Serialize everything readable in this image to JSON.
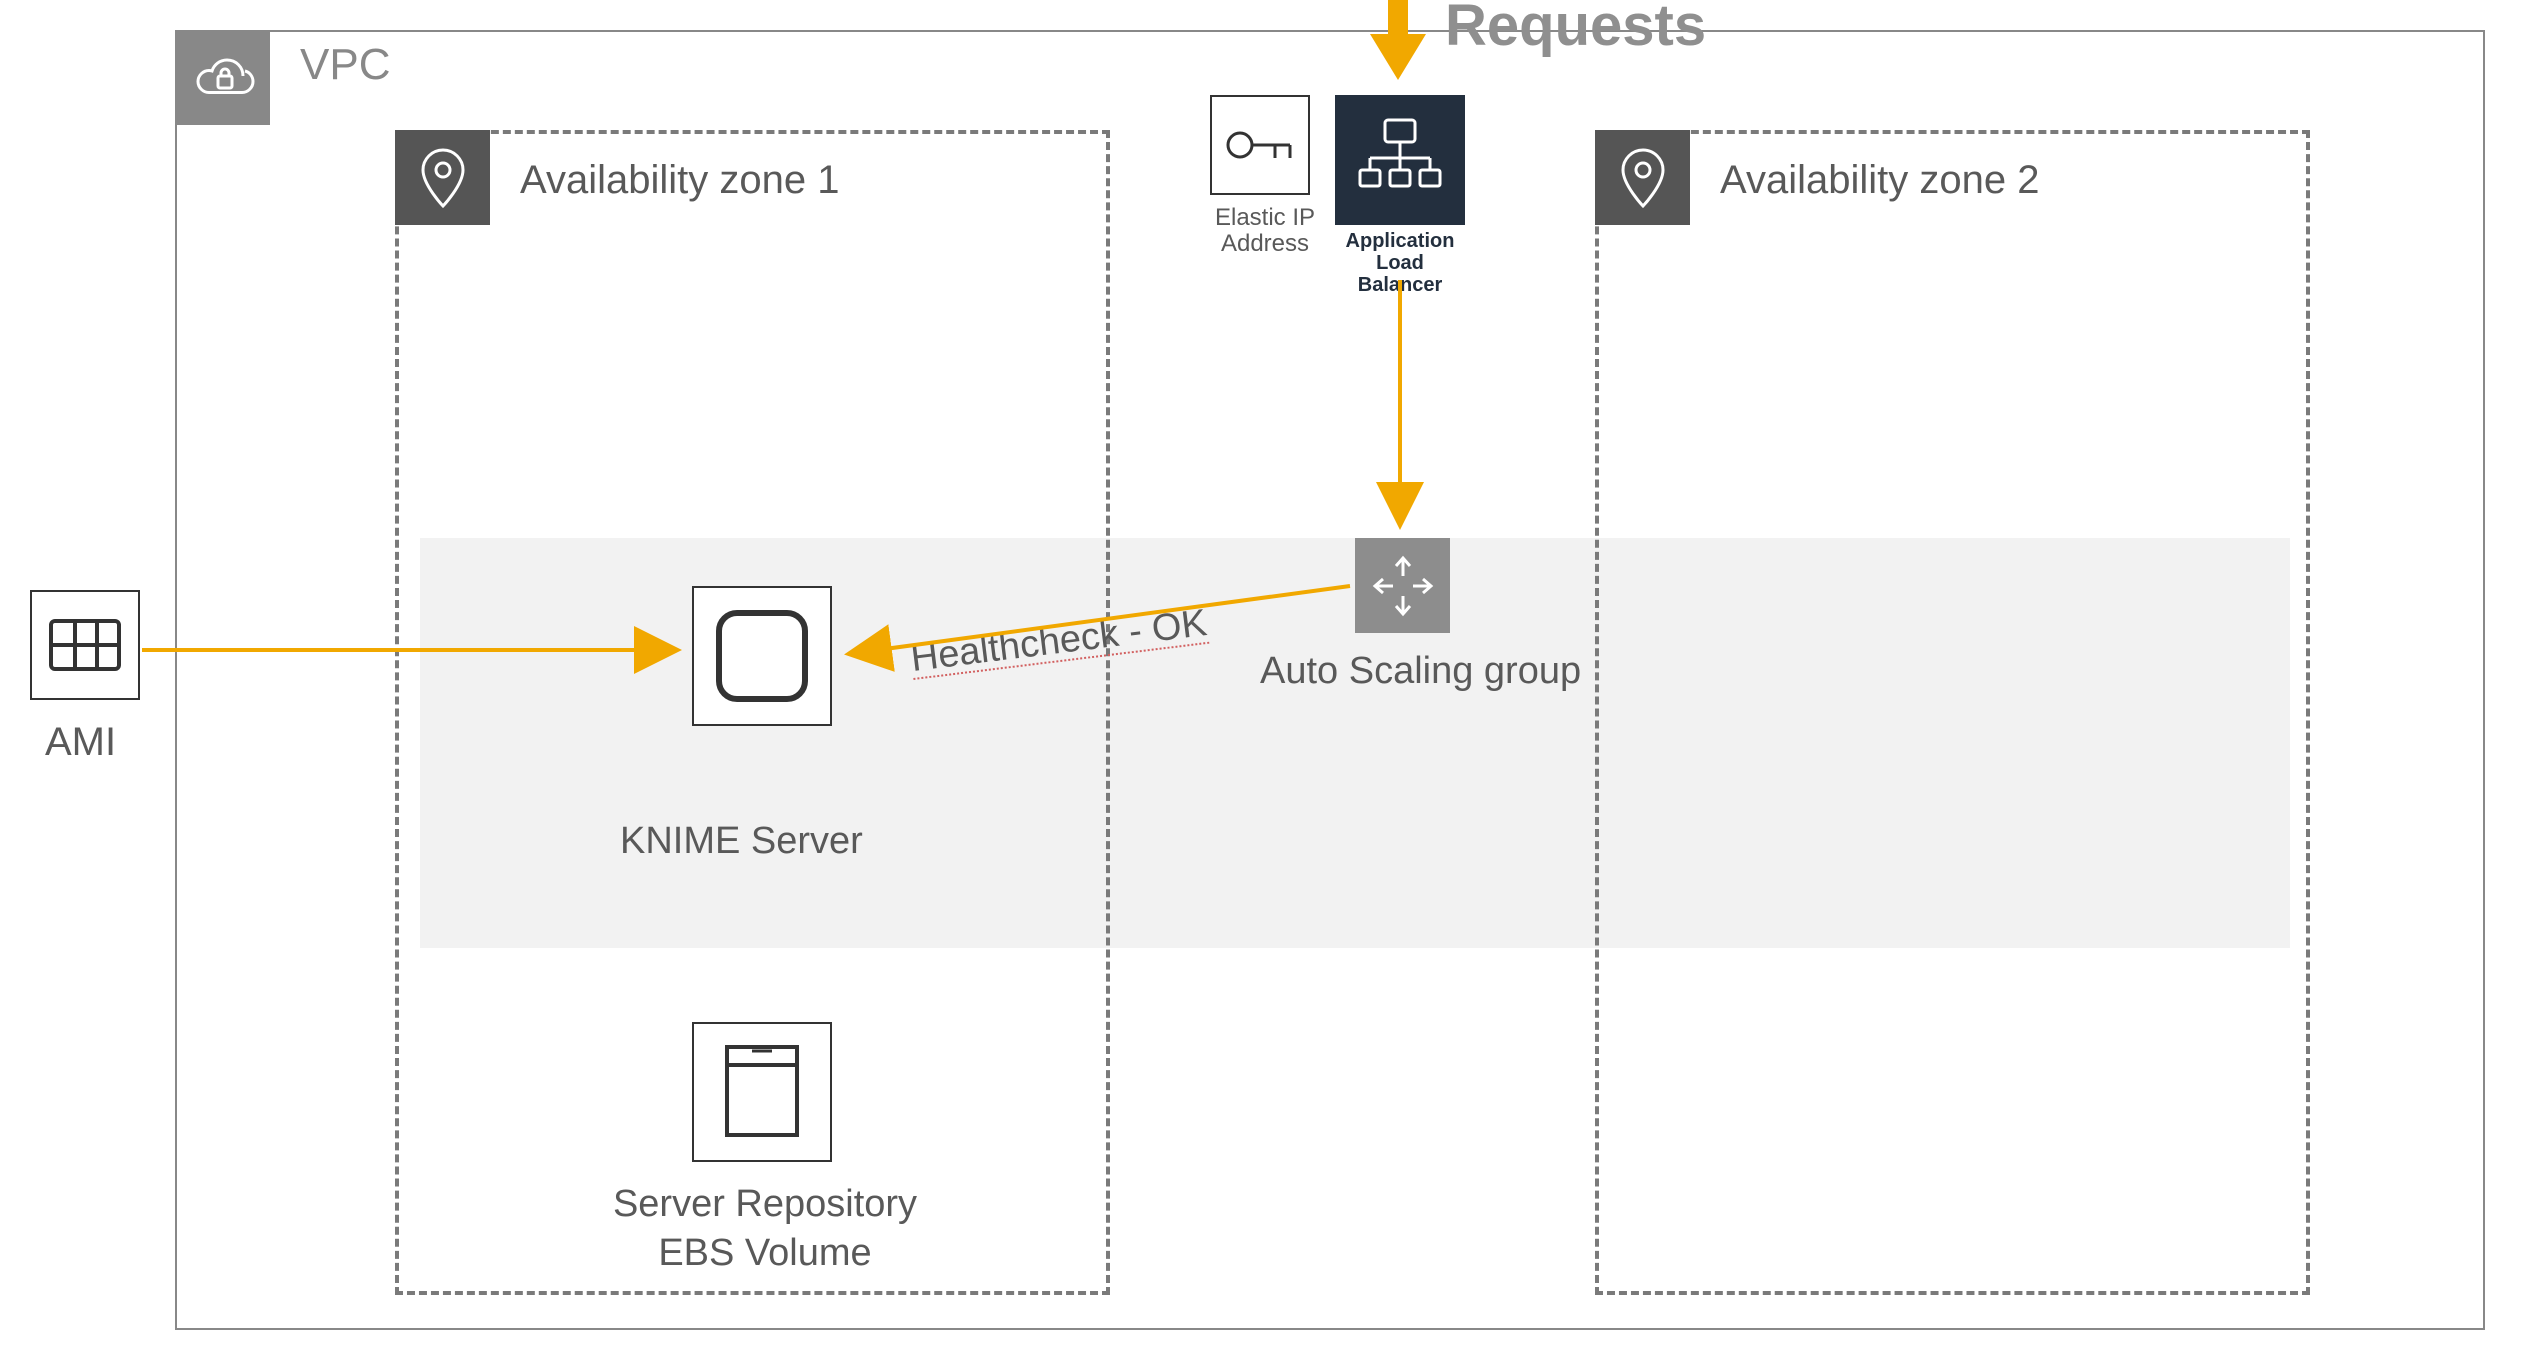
{
  "requests_label": "Requests",
  "vpc": {
    "label": "VPC"
  },
  "zones": {
    "az1": {
      "label": "Availability zone 1"
    },
    "az2": {
      "label": "Availability zone 2"
    }
  },
  "eip": {
    "label_line1": "Elastic IP",
    "label_line2": "Address"
  },
  "alb": {
    "label_line1": "Application",
    "label_line2": "Load Balancer"
  },
  "asg": {
    "label": "Auto Scaling group"
  },
  "healthcheck": {
    "label": "Healthcheck - OK"
  },
  "knime": {
    "label": "KNIME Server"
  },
  "ebs": {
    "label_line1": "Server Repository",
    "label_line2": "EBS Volume"
  },
  "ami": {
    "label": "AMI"
  },
  "colors": {
    "accent": "#f1a800",
    "dark": "#232f3e",
    "gray": "#8d8d8d"
  }
}
